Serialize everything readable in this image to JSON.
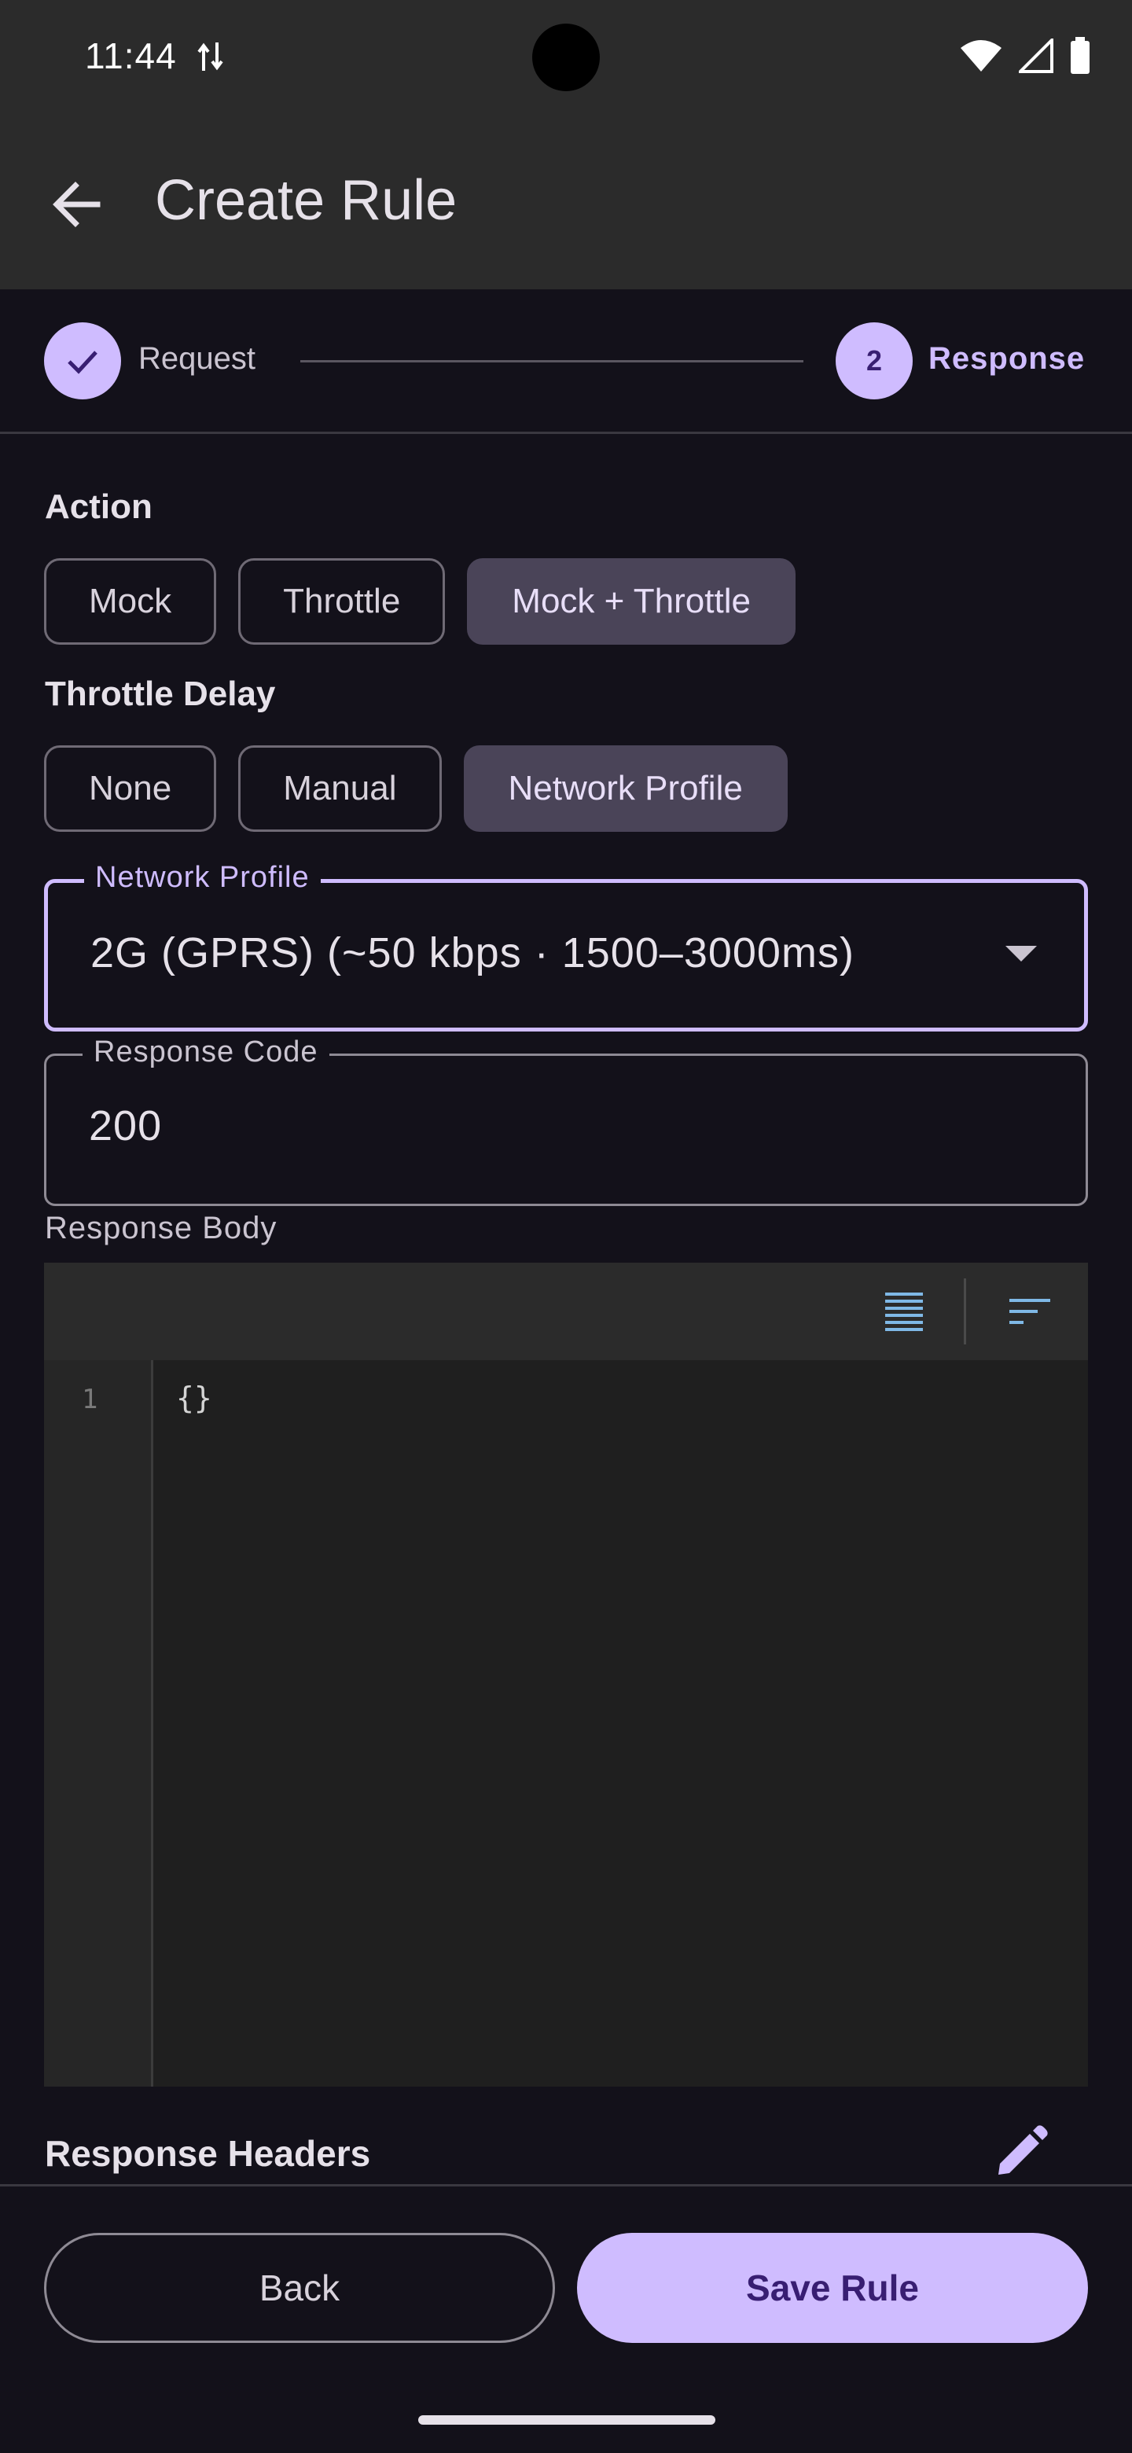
{
  "status_bar": {
    "time": "11:44"
  },
  "app_bar": {
    "title": "Create Rule"
  },
  "stepper": {
    "step1_label": "Request",
    "step2_number": "2",
    "step2_label": "Response"
  },
  "action": {
    "label": "Action",
    "options": [
      "Mock",
      "Throttle",
      "Mock + Throttle"
    ],
    "selected": "Mock + Throttle"
  },
  "throttle_delay": {
    "label": "Throttle Delay",
    "options": [
      "None",
      "Manual",
      "Network Profile"
    ],
    "selected": "Network Profile"
  },
  "network_profile": {
    "label": "Network Profile",
    "value": "2G (GPRS)  (~50 kbps · 1500–3000ms)"
  },
  "response_code": {
    "label": "Response Code",
    "value": "200"
  },
  "response_body": {
    "label": "Response Body",
    "line_number": "1",
    "content": "{}"
  },
  "response_headers": {
    "label": "Response Headers"
  },
  "buttons": {
    "back": "Back",
    "save": "Save Rule"
  },
  "colors": {
    "accent": "#cfbcff",
    "on_accent": "#381e72",
    "selected_chip": "#4a4458",
    "background": "#13111a",
    "bar": "#2b2b2b",
    "editor_icon": "#7fb8e6"
  },
  "icons": {
    "back": "arrow-back-icon",
    "check": "check-icon",
    "dropdown": "arrow-drop-down-icon",
    "wrap": "text-wrap-icon",
    "format": "format-sort-icon",
    "edit": "pencil-icon"
  }
}
